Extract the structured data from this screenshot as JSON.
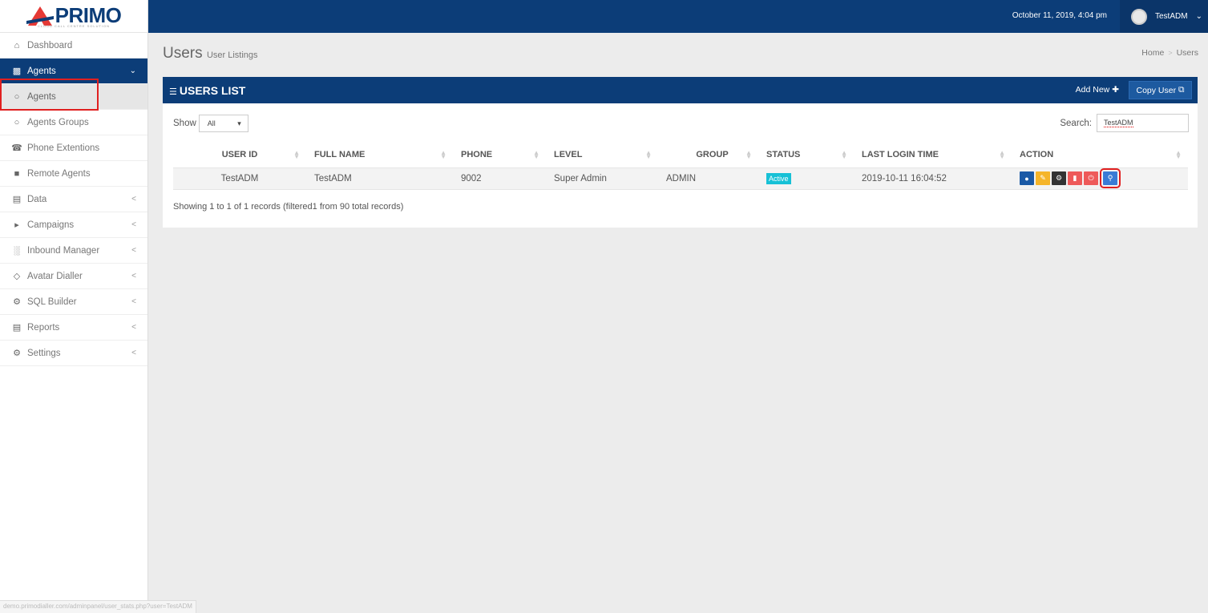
{
  "brand": {
    "name": "PRIMO",
    "tagline": "CLOUD CALL CENTRE SOLUTION"
  },
  "topbar": {
    "datetime": "October 11, 2019, 4:04 pm",
    "username": "TestADM"
  },
  "sidebar": {
    "items": [
      {
        "label": "Dashboard",
        "icon": "home-icon"
      },
      {
        "label": "Agents",
        "icon": "users-icon",
        "chevron": "⌄"
      },
      {
        "label": "Agents",
        "icon": "user-outline-icon"
      },
      {
        "label": "Agents Groups",
        "icon": "group-icon"
      },
      {
        "label": "Phone Extentions",
        "icon": "phone-icon"
      },
      {
        "label": "Remote Agents",
        "icon": "remote-user-icon"
      },
      {
        "label": "Data",
        "icon": "database-icon",
        "chevron": "<"
      },
      {
        "label": "Campaigns",
        "icon": "megaphone-icon",
        "chevron": "<"
      },
      {
        "label": "Inbound Manager",
        "icon": "bar-chart-icon",
        "chevron": "<"
      },
      {
        "label": "Avatar Dialler",
        "icon": "tag-icon",
        "chevron": "<"
      },
      {
        "label": "SQL Builder",
        "icon": "gear-icon",
        "chevron": "<"
      },
      {
        "label": "Reports",
        "icon": "report-icon",
        "chevron": "<"
      },
      {
        "label": "Settings",
        "icon": "gear-icon",
        "chevron": "<"
      }
    ]
  },
  "page": {
    "title": "Users",
    "subtitle": "User Listings",
    "breadcrumb": [
      "Home",
      "Users"
    ],
    "breadcrumb_sep": ">"
  },
  "panel": {
    "title": "USERS LIST",
    "add_new": "Add New",
    "copy_user": "Copy User",
    "show_label": "Show",
    "show_value": "All",
    "search_label": "Search:",
    "search_value": "TestADM",
    "records_text": "Showing 1 to 1 of 1 records (filtered1 from 90 total records)"
  },
  "table": {
    "columns": [
      "USER ID",
      "FULL NAME",
      "PHONE",
      "LEVEL",
      "GROUP",
      "STATUS",
      "LAST LOGIN TIME",
      "ACTION"
    ],
    "rows": [
      {
        "user_id": "TestADM",
        "full_name": "TestADM",
        "phone": "9002",
        "level": "Super Admin",
        "group": "ADMIN",
        "status": "Active",
        "last_login": "2019-10-11 16:04:52"
      }
    ]
  },
  "status_url": "demo.primodialler.com/adminpanel/user_stats.php?user=TestADM",
  "colors": {
    "primary": "#0c3d78",
    "active_badge": "#17c1d6",
    "highlight": "#e02020"
  }
}
